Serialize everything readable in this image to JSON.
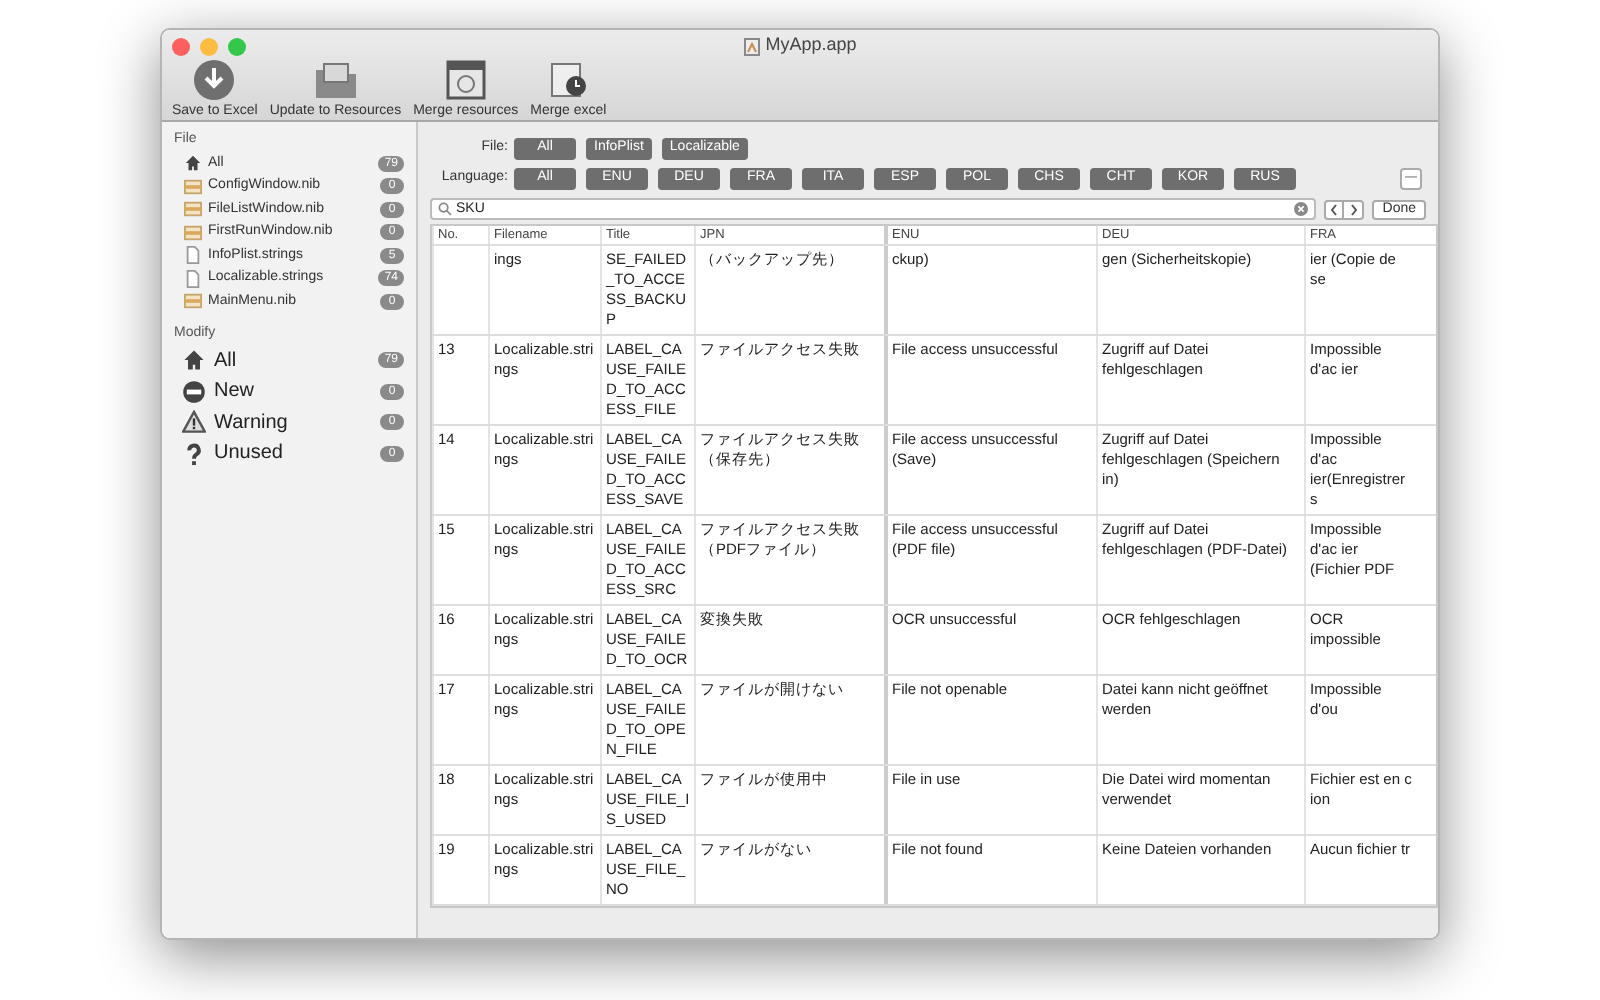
{
  "window": {
    "title": "MyApp.app"
  },
  "toolbar": [
    {
      "label": "Save to Excel",
      "kind": "save"
    },
    {
      "label": "Update to Resources",
      "kind": "update"
    },
    {
      "label": "Merge resources",
      "kind": "merge"
    },
    {
      "label": "Merge excel",
      "kind": "excel"
    }
  ],
  "sidebar": [
    {
      "heading": "File",
      "kind": "compact",
      "items": [
        {
          "label": "All",
          "count": "79",
          "kind": "home"
        },
        {
          "label": "ConfigWindow.nib",
          "count": "0",
          "kind": "nib"
        },
        {
          "label": "FileListWindow.nib",
          "count": "0",
          "kind": "nib"
        },
        {
          "label": "FirstRunWindow.nib",
          "count": "0",
          "kind": "nib"
        },
        {
          "label": "InfoPlist.strings",
          "count": "5",
          "kind": "strings"
        },
        {
          "label": "Localizable.strings",
          "count": "74",
          "kind": "strings"
        },
        {
          "label": "MainMenu.nib",
          "count": "0",
          "kind": "nib"
        }
      ]
    },
    {
      "heading": "Modify",
      "kind": "large",
      "items": [
        {
          "label": "All",
          "count": "79",
          "kind": "home"
        },
        {
          "label": "New",
          "count": "0",
          "kind": "new"
        },
        {
          "label": "Warning",
          "count": "0",
          "kind": "warning"
        },
        {
          "label": "Unused",
          "count": "0",
          "kind": "unused"
        }
      ]
    }
  ],
  "filters": [
    {
      "label": "File:",
      "options": [
        "All",
        "InfoPlist",
        "Localizable"
      ]
    },
    {
      "label": "Language:",
      "options": [
        "All",
        "ENU",
        "DEU",
        "FRA",
        "ITA",
        "ESP",
        "POL",
        "CHS",
        "CHT",
        "KOR",
        "RUS"
      ]
    }
  ],
  "collapse_button": "—",
  "search": {
    "value": "SKU"
  },
  "done_button": "Done",
  "table": {
    "columns": [
      "No.",
      "Filename",
      "Title",
      "JPN",
      "ENU",
      "DEU",
      "FRA"
    ],
    "rows": [
      [
        "",
        "ings",
        "SE_FAILED_TO_ACCESS_BACKUP",
        "（バックアップ先）",
        "ckup)",
        "gen (Sicherheitskopie)",
        "ier (Copie de se"
      ],
      [
        "13",
        "Localizable.strings",
        "LABEL_CAUSE_FAILED_TO_ACCESS_FILE",
        "ファイルアクセス失敗",
        "File access unsuccessful",
        "Zugriff auf Datei fehlgeschlagen",
        "Impossible d'ac ier"
      ],
      [
        "14",
        "Localizable.strings",
        "LABEL_CAUSE_FAILED_TO_ACCESS_SAVE",
        "ファイルアクセス失敗（保存先）",
        "File access unsuccessful (Save)",
        "Zugriff auf Datei fehlgeschlagen (Speichern in)",
        "Impossible d'ac ier(Enregistrer s"
      ],
      [
        "15",
        "Localizable.strings",
        "LABEL_CAUSE_FAILED_TO_ACCESS_SRC",
        "ファイルアクセス失敗（PDFファイル）",
        "File access unsuccessful (PDF file)",
        "Zugriff auf Datei fehlgeschlagen (PDF-Datei)",
        "Impossible d'ac ier (Fichier PDF"
      ],
      [
        "16",
        "Localizable.strings",
        "LABEL_CAUSE_FAILED_TO_OCR",
        "変換失敗",
        "OCR unsuccessful",
        "OCR fehlgeschlagen",
        "OCR impossible"
      ],
      [
        "17",
        "Localizable.strings",
        "LABEL_CAUSE_FAILED_TO_OPEN_FILE",
        "ファイルが開けない",
        "File not openable",
        "Datei kann nicht geöffnet werden",
        "Impossible d'ou"
      ],
      [
        "18",
        "Localizable.strings",
        "LABEL_CAUSE_FILE_IS_USED",
        "ファイルが使用中",
        "File in use",
        "Die Datei wird momentan verwendet",
        "Fichier est en c ion"
      ],
      [
        "19",
        "Localizable.strings",
        "LABEL_CAUSE_FILE_NO",
        "ファイルがない",
        "File not found",
        "Keine Dateien vorhanden",
        "Aucun fichier tr"
      ]
    ]
  }
}
